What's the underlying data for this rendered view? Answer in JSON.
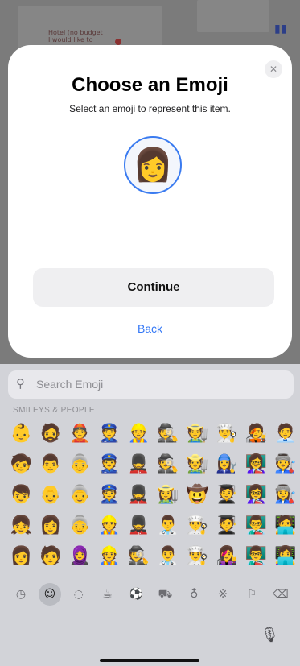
{
  "background": {
    "map_label_line1": "Hotel (no budget",
    "map_label_line2": "I would like to",
    "map_icon": "map-icon"
  },
  "sheet": {
    "title": "Choose an Emoji",
    "subtitle": "Select an emoji to represent this item.",
    "selected_emoji": "👩",
    "close_glyph": "✕",
    "continue_label": "Continue",
    "back_label": "Back",
    "accent_color": "#3478f6"
  },
  "keyboard": {
    "search_placeholder": "Search Emoji",
    "search_icon_glyph": "🔍",
    "category_label": "SMILEYS & PEOPLE",
    "emoji_rows": [
      [
        "👶",
        "🧔",
        "👲",
        "👮",
        "👷",
        "🕵️",
        "🧑‍🌾",
        "👨‍🍳",
        "🧑‍🎤",
        "🧑‍💼"
      ],
      [
        "🧒",
        "👨",
        "👵",
        "👮",
        "💂",
        "🕵️",
        "🧑‍🌾",
        "👩‍🔧",
        "👩‍🏫",
        "🧑‍🏭"
      ],
      [
        "👦",
        "👴",
        "👵",
        "👮",
        "💂",
        "👩‍🌾",
        "🤠",
        "🧑‍🎓",
        "👩‍🏫",
        "👩‍🏭"
      ],
      [
        "👧",
        "👩",
        "👵",
        "👷",
        "💂",
        "👨‍⚕️",
        "👨‍🍳",
        "🧑‍🎓",
        "👨‍🏫",
        "🧑‍💻"
      ],
      [
        "👩",
        "🧑",
        "🧕",
        "👷",
        "🕵️",
        "👨‍⚕️",
        "👨‍🍳",
        "👩‍🎤",
        "👨‍🏫",
        "👩‍💻"
      ]
    ],
    "tabs": [
      {
        "name": "recent-icon",
        "glyph": "◷"
      },
      {
        "name": "smileys-icon",
        "glyph": "☺"
      },
      {
        "name": "animals-icon",
        "glyph": "◌"
      },
      {
        "name": "food-icon",
        "glyph": "☕"
      },
      {
        "name": "activity-icon",
        "glyph": "⚽"
      },
      {
        "name": "travel-icon",
        "glyph": "⛟"
      },
      {
        "name": "objects-icon",
        "glyph": "♁"
      },
      {
        "name": "symbols-icon",
        "glyph": "※"
      },
      {
        "name": "flags-icon",
        "glyph": "⚐"
      },
      {
        "name": "delete-icon",
        "glyph": "⌫"
      }
    ],
    "active_tab": "smileys-icon",
    "mic_glyph": "🎙"
  }
}
